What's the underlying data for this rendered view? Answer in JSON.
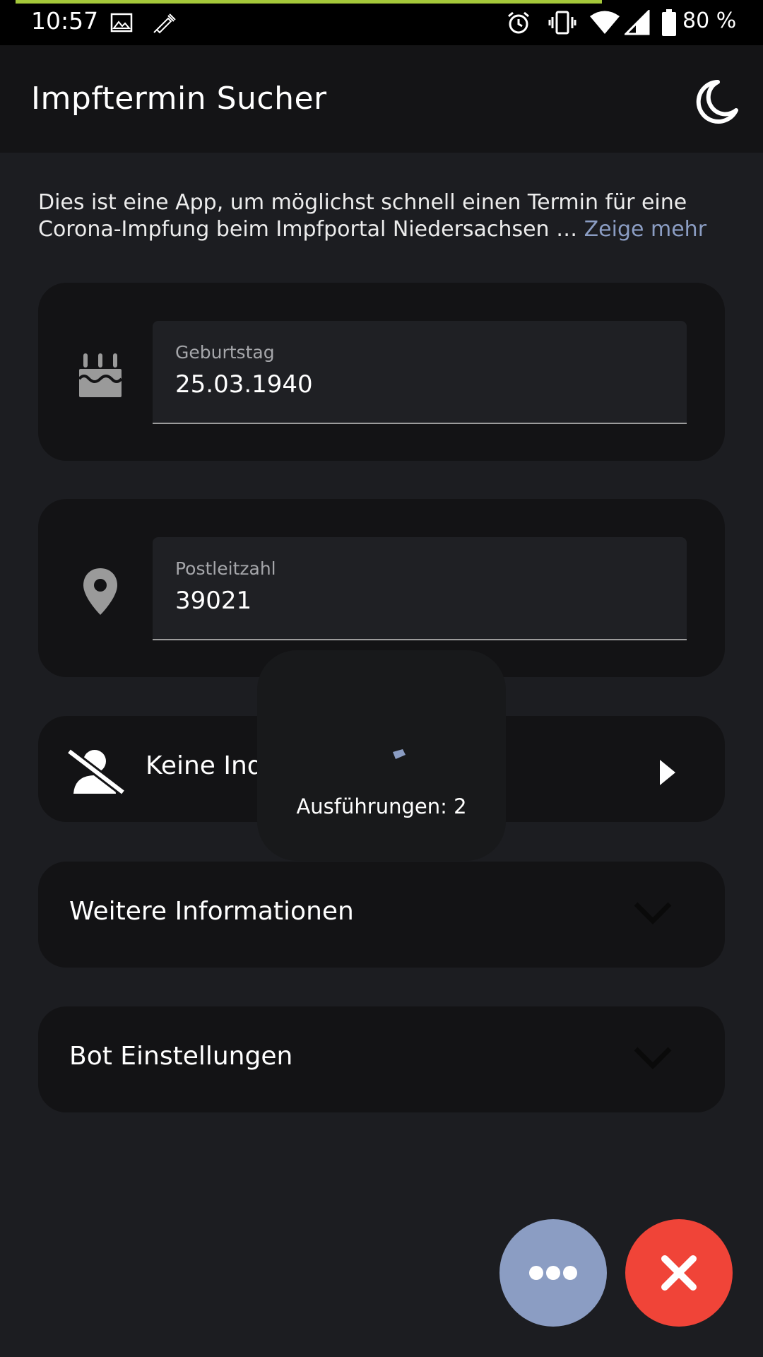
{
  "status_bar": {
    "time": "10:57",
    "battery": "80 %",
    "icons": [
      "image-icon",
      "syringe-icon",
      "alarm-icon",
      "vibrate-icon",
      "wifi-icon",
      "signal-icon",
      "battery-icon"
    ]
  },
  "app": {
    "title": "Impftermin Sucher",
    "theme_icon": "moon-icon"
  },
  "intro": {
    "text": "Dies ist eine App, um möglichst schnell einen Termin für eine Corona-Impfung beim Impfportal Niedersachsen … ",
    "more_link": "Zeige mehr"
  },
  "birthday": {
    "label": "Geburtstag",
    "value": "25.03.1940",
    "icon": "birthday-cake-icon"
  },
  "zip": {
    "label": "Postleitzahl",
    "value": "39021",
    "icon": "location-pin-icon"
  },
  "indication": {
    "label": "Keine Ind",
    "icon": "person-off-icon"
  },
  "sections": {
    "more_info": "Weitere Informationen",
    "bot_settings": "Bot Einstellungen"
  },
  "loader": {
    "text": "Ausführungen: 2"
  },
  "colors": {
    "accent": "#8b9dc3",
    "danger": "#f04438",
    "progress": "#a5c83a"
  }
}
